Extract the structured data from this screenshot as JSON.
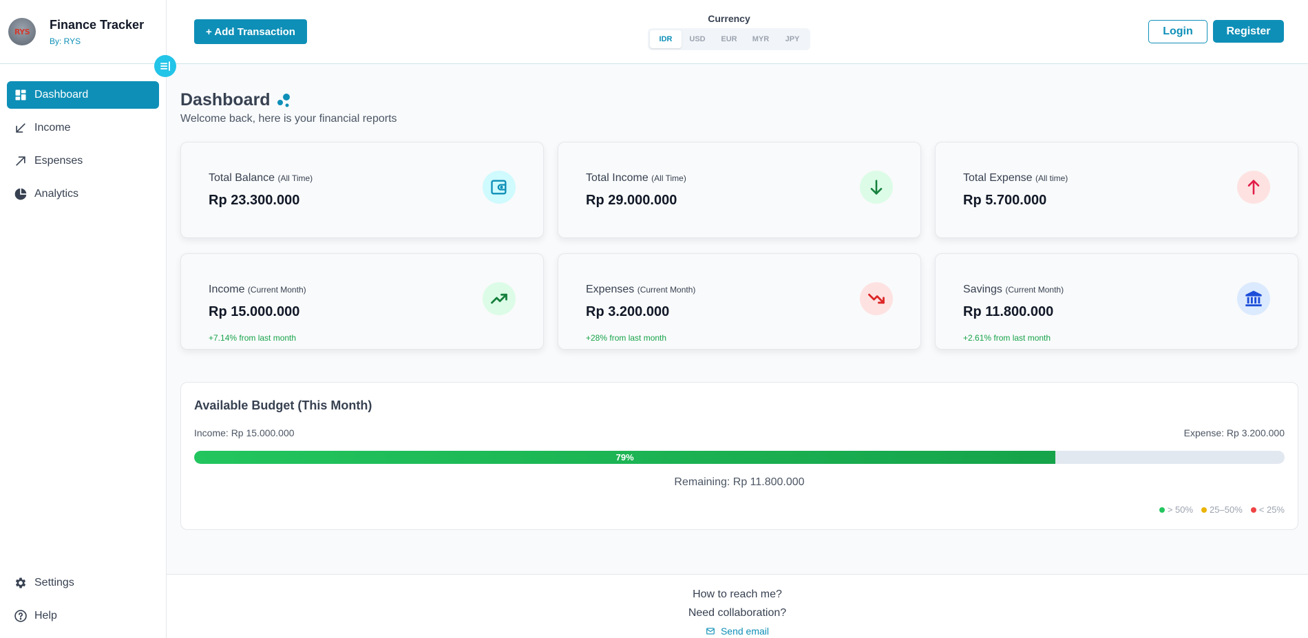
{
  "brand": {
    "title": "Finance Tracker",
    "subtitle": "By: RYS",
    "avatar_text": "RYS"
  },
  "sidebar": {
    "items": [
      {
        "label": "Dashboard",
        "icon": "dashboard-icon",
        "active": true
      },
      {
        "label": "Income",
        "icon": "arrow-down-left-icon"
      },
      {
        "label": "Espenses",
        "icon": "arrow-up-right-icon"
      },
      {
        "label": "Analytics",
        "icon": "pie-chart-icon"
      }
    ],
    "bottom_items": [
      {
        "label": "Settings",
        "icon": "gear-icon"
      },
      {
        "label": "Help",
        "icon": "help-icon"
      }
    ]
  },
  "topbar": {
    "add_label": "+ Add Transaction",
    "currency_label": "Currency",
    "currencies": [
      "IDR",
      "USD",
      "EUR",
      "MYR",
      "JPY"
    ],
    "selected_currency": "IDR",
    "login_label": "Login",
    "register_label": "Register"
  },
  "header": {
    "title": "Dashboard",
    "subtitle": "Welcome back, here is your financial reports"
  },
  "cards": [
    {
      "label": "Total Balance",
      "period": "(All Time)",
      "value": "Rp 23.300.000",
      "change": "",
      "icon": "wallet-icon",
      "color": "#0e8fb7",
      "bg": "#cffafe"
    },
    {
      "label": "Total Income",
      "period": "(All Time)",
      "value": "Rp 29.000.000",
      "change": "",
      "icon": "arrow-down-icon",
      "color": "#15803d",
      "bg": "#dcfce7"
    },
    {
      "label": "Total Expense",
      "period": "(All time)",
      "value": "Rp 5.700.000",
      "change": "",
      "icon": "arrow-up-icon",
      "color": "#e11d48",
      "bg": "#fee2e2"
    },
    {
      "label": "Income",
      "period": "(Current Month)",
      "value": "Rp 15.000.000",
      "change": "+7.14% from last month",
      "icon": "trending-up-icon",
      "color": "#15803d",
      "bg": "#dcfce7"
    },
    {
      "label": "Expenses",
      "period": "(Current Month)",
      "value": "Rp 3.200.000",
      "change": "+28% from last month",
      "icon": "trending-down-icon",
      "color": "#dc2626",
      "bg": "#fee2e2"
    },
    {
      "label": "Savings",
      "period": "(Current Month)",
      "value": "Rp 11.800.000",
      "change": "+2.61% from last month",
      "icon": "bank-icon",
      "color": "#1d4ed8",
      "bg": "#dbeafe"
    }
  ],
  "budget": {
    "title": "Available Budget (This Month)",
    "income_text": "Income: Rp 15.000.000",
    "expense_text": "Expense: Rp 3.200.000",
    "percent": 79,
    "percent_label": "79%",
    "remaining_text": "Remaining: Rp 11.800.000",
    "legend": [
      {
        "label": "> 50%",
        "color": "#22c55e"
      },
      {
        "label": "25–50%",
        "color": "#eab308"
      },
      {
        "label": "< 25%",
        "color": "#ef4444"
      }
    ]
  },
  "footer": {
    "line1": "How to reach me?",
    "line2": "Need collaboration?",
    "email_label": "Send email"
  }
}
